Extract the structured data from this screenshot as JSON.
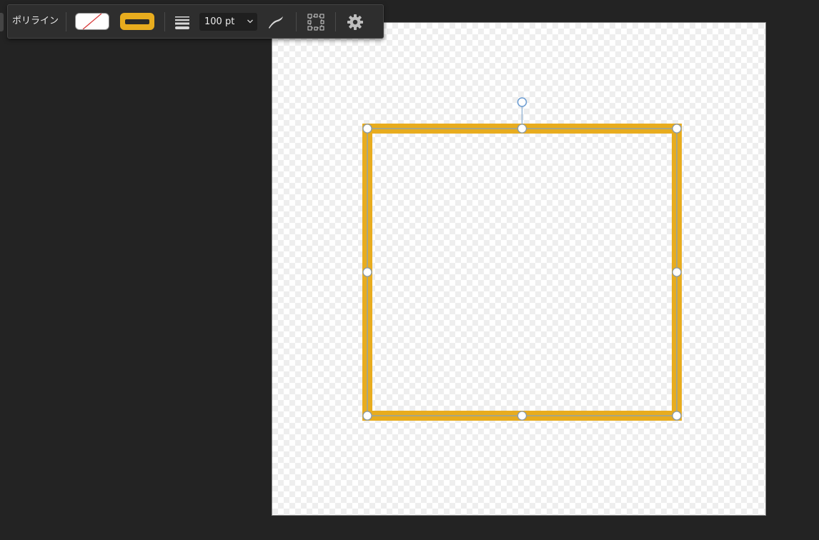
{
  "toolbar": {
    "tool_name": "ポリライン",
    "fill": {
      "color": "#ffffff",
      "state": "none"
    },
    "stroke": {
      "color": "#e8ac1e"
    },
    "line_style_icon": "line-weight-icon",
    "stroke_width": "100 pt",
    "pressure_icon": "pressure-curve-icon",
    "transform_icon": "transform-bounds-icon",
    "settings_icon": "gear-icon"
  },
  "document": {
    "background": "transparent-checkerboard"
  },
  "shape": {
    "type": "polyline-rectangle",
    "stroke_color": "#e8ac1e",
    "outline_color": "#7fa3c4",
    "handle_color": "#ffffff",
    "selected": true
  }
}
